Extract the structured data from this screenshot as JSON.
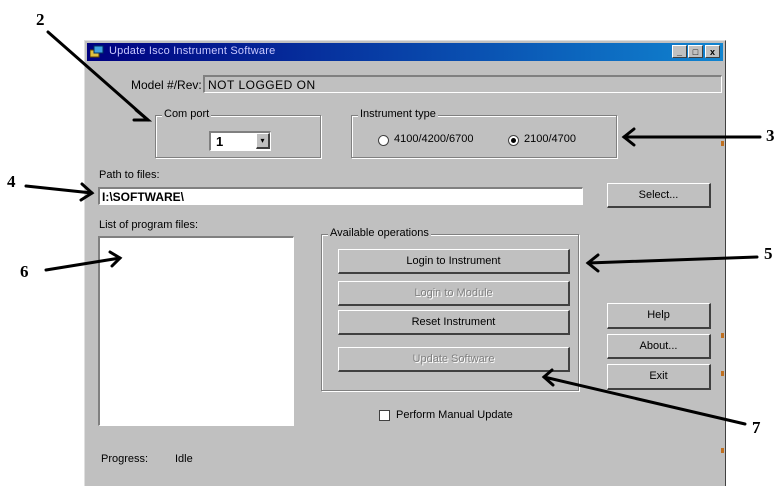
{
  "window": {
    "title": "Update Isco Instrument Software",
    "controls": [
      "_",
      "□",
      "x"
    ]
  },
  "model": {
    "label": "Model #/Rev:",
    "value": "NOT LOGGED ON"
  },
  "com_port": {
    "legend": "Com port",
    "value": "1"
  },
  "instrument_type": {
    "legend": "Instrument type",
    "options": [
      {
        "label": "4100/4200/6700",
        "selected": false
      },
      {
        "label": "2100/4700",
        "selected": true
      }
    ]
  },
  "path": {
    "label": "Path to files:",
    "value": "I:\\SOFTWARE\\",
    "select_button": "Select..."
  },
  "program_files": {
    "label": "List of program files:"
  },
  "operations": {
    "legend": "Available operations",
    "buttons": [
      {
        "label": "Login to Instrument",
        "enabled": true
      },
      {
        "label": "Login to Module",
        "enabled": false
      },
      {
        "label": "Reset Instrument",
        "enabled": true
      },
      {
        "label": "Update Software",
        "enabled": false
      }
    ]
  },
  "side_buttons": {
    "help": "Help",
    "about": "About...",
    "exit": "Exit"
  },
  "manual_update": {
    "label": "Perform Manual Update",
    "checked": false
  },
  "progress": {
    "label": "Progress:",
    "value": "Idle"
  },
  "annotations": [
    "2",
    "3",
    "4",
    "5",
    "6",
    "7"
  ]
}
